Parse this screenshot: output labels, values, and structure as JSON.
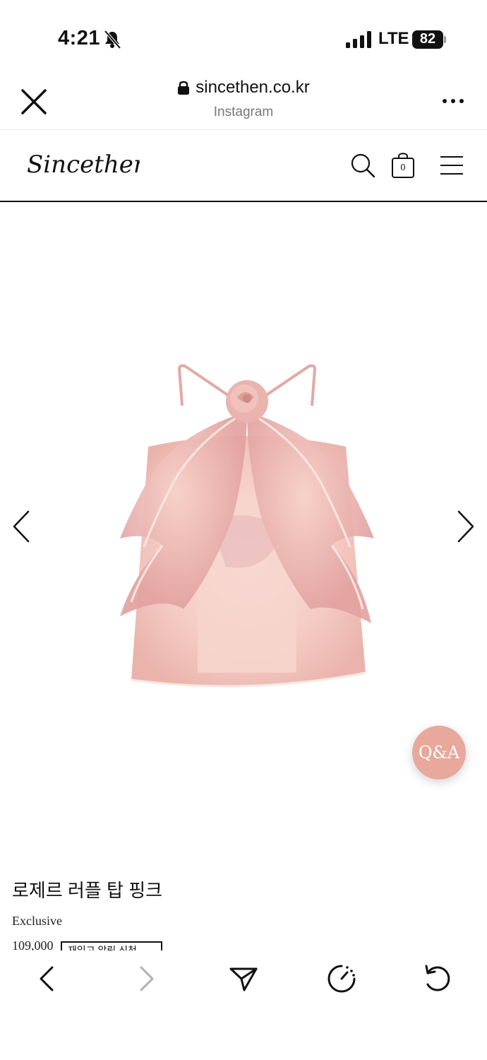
{
  "status_bar": {
    "time": "4:21",
    "network": "LTE",
    "battery": "82"
  },
  "browser": {
    "url": "sincethen.co.kr",
    "source": "Instagram"
  },
  "site": {
    "logo": "Sincethen",
    "cart_count": "0"
  },
  "product": {
    "name": "로제르 러플 탑 핑크",
    "badge": "Exclusive",
    "price": "109,000",
    "restock_label": "재입고 알림 신청"
  },
  "qa_button": "Q&A",
  "colors": {
    "accent_qa": "#e8a89c",
    "forward_disabled": "#b0b0b0"
  },
  "icons": [
    "close-icon",
    "lock-icon",
    "more-icon",
    "search-icon",
    "cart-icon",
    "menu-icon",
    "chevron-left-icon",
    "chevron-right-icon",
    "share-icon",
    "speed-icon",
    "reload-icon"
  ]
}
